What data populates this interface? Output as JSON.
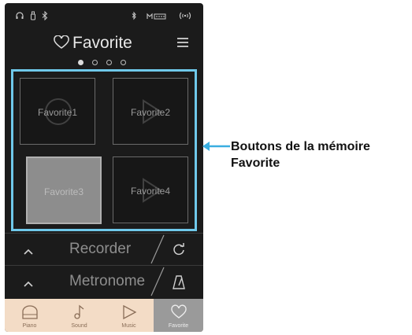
{
  "screen": {
    "title": "Favorite",
    "status_icons": [
      "headphones-icon",
      "usb-icon",
      "bluetooth-icon",
      "bluetooth-audio-icon",
      "midi-icon",
      "wireless-icon"
    ],
    "page_indicator": {
      "count": 4,
      "active_index": 0
    },
    "favorites": [
      {
        "label": "Favorite1",
        "selected": false
      },
      {
        "label": "Favorite2",
        "selected": false
      },
      {
        "label": "Favorite3",
        "selected": true
      },
      {
        "label": "Favorite4",
        "selected": false
      }
    ],
    "panels": [
      {
        "label": "Recorder",
        "icon": "loop-icon"
      },
      {
        "label": "Metronome",
        "icon": "metronome-icon"
      }
    ],
    "tabs": [
      {
        "label": "Piano",
        "icon": "piano-icon"
      },
      {
        "label": "Sound",
        "icon": "music-note-icon"
      },
      {
        "label": "Music",
        "icon": "play-icon"
      },
      {
        "label": "Favorite",
        "icon": "heart-icon",
        "active": true
      }
    ]
  },
  "annotation": {
    "line1": "Boutons de la mémoire",
    "line2": "Favorite"
  },
  "colors": {
    "highlight": "#6fc8ea",
    "background": "#1b1b1b",
    "tabbar": "#f3dcc6"
  }
}
